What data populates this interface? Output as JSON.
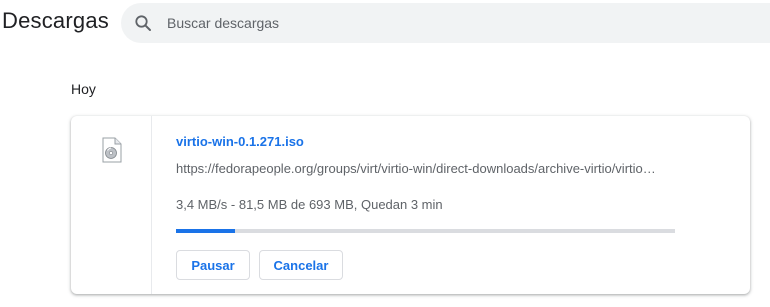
{
  "header": {
    "title": "Descargas",
    "search": {
      "placeholder": "Buscar descargas",
      "icon": "search-icon"
    }
  },
  "section": {
    "label": "Hoy"
  },
  "download": {
    "filename": "virtio-win-0.1.271.iso",
    "url": "https://fedorapeople.org/groups/virt/virtio-win/direct-downloads/archive-virtio/virtio…",
    "status": "3,4 MB/s - 81,5 MB de 693 MB, Quedan 3 min",
    "progress_percent": 11.8,
    "file_icon": "disc-image-file-icon",
    "buttons": {
      "pause": "Pausar",
      "cancel": "Cancelar"
    }
  },
  "colors": {
    "accent": "#1a73e8",
    "search_bg": "#f1f3f4",
    "progress_track": "#dadce0"
  }
}
